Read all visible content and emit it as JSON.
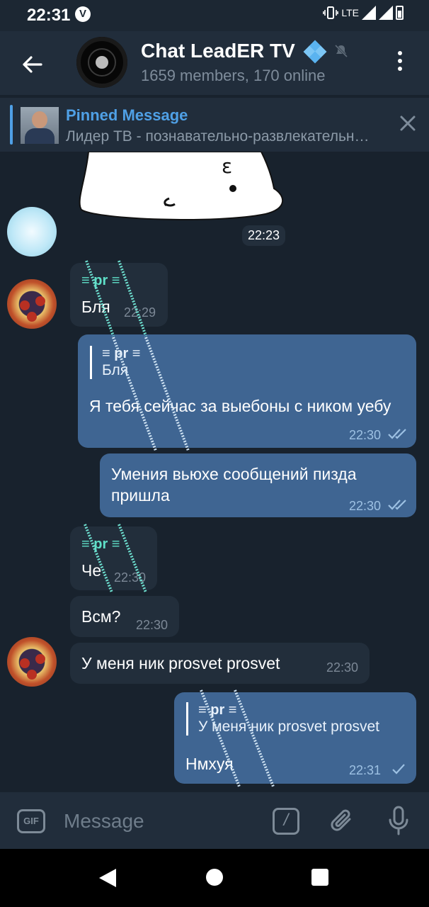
{
  "status_bar": {
    "time": "22:31",
    "carrier_badge": "V",
    "network": "LTE",
    "icons": [
      "vibrate-icon",
      "signal-icon",
      "battery-icon"
    ]
  },
  "header": {
    "back_icon": "arrow-left-icon",
    "title": "Chat LeadER TV",
    "subtitle": "1659 members, 170 online",
    "verified_icon": "diamond-icon",
    "muted_icon": "muted-bell-icon",
    "more_icon": "more-vertical-icon"
  },
  "pinned": {
    "title": "Pinned Message",
    "text": "Лидер ТВ - познавательно-развлекательный канал"
  },
  "messages": [
    {
      "type": "sticker",
      "time": "22:23"
    },
    {
      "dir": "in",
      "sender": "≡ pr ≡",
      "text": "Бля",
      "time": "22:29"
    },
    {
      "dir": "out",
      "reply_sender": "≡ pr ≡",
      "reply_text": "Бля",
      "text": "Я тебя сейчас за выебоны с ником уебу",
      "time": "22:30",
      "status": "read"
    },
    {
      "dir": "out",
      "text": "Умения вьюхе сообщений пизда пришла",
      "time": "22:30",
      "status": "read"
    },
    {
      "dir": "in",
      "sender": "≡ pr ≡",
      "text": "Че",
      "time": "22:30"
    },
    {
      "dir": "in",
      "text": "Всм?",
      "time": "22:30"
    },
    {
      "dir": "in",
      "text": "У меня ник prosvet prosvet",
      "time": "22:30"
    },
    {
      "dir": "out",
      "reply_sender": "≡ pr ≡",
      "reply_text": "У меня ник prosvet prosvet",
      "text": "Нмхуя",
      "time": "22:31",
      "status": "sent"
    }
  ],
  "input_bar": {
    "gif_label": "GIF",
    "placeholder": "Message",
    "command_label": "/",
    "attach_icon": "paperclip-icon",
    "mic_icon": "microphone-icon"
  },
  "colors": {
    "accent": "#4fa0e6",
    "bubble_out": "#3f6592",
    "bubble_in": "#222e3b",
    "background": "#18222d",
    "sender_name": "#5fe0c8"
  }
}
